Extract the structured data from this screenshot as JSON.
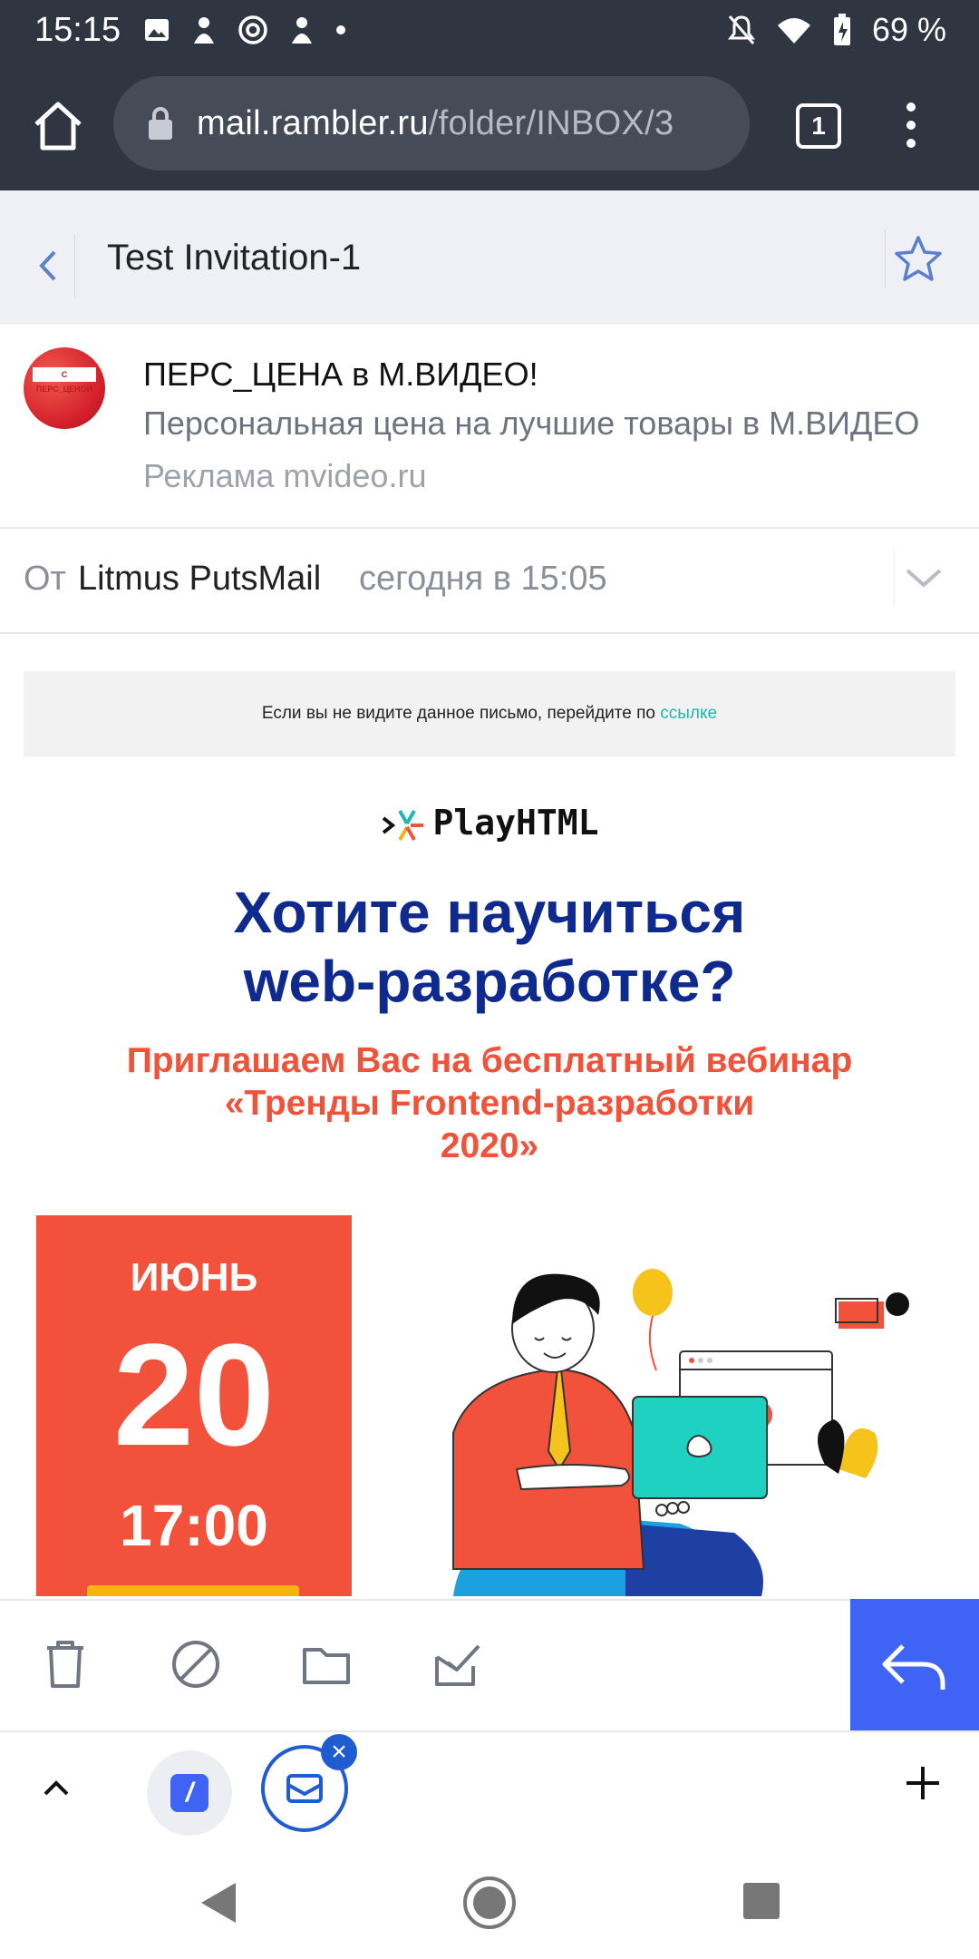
{
  "status_bar": {
    "time": "15:15",
    "battery": "69 %"
  },
  "browser": {
    "url_host": "mail.rambler.ru",
    "url_path": "/folder/INBOX/3",
    "tab_count": "1"
  },
  "mail": {
    "subject": "Test Invitation-1",
    "ad": {
      "avatar_text": "С ПЕРС_ЦЕНОЙ",
      "title": "ПЕРС_ЦЕНА в М.ВИДЕО!",
      "description": "Персональная цена на лучшие товары в М.ВИДЕО",
      "source": "Реклама mvideo.ru"
    },
    "from_label": "От",
    "from_name": "Litmus PutsMail",
    "received": "сегодня в 15:05"
  },
  "email_body": {
    "banner_text": "Если вы не видите данное письмо, перейдите по ",
    "banner_link": "ссылке",
    "logo_text": "PlayHTML",
    "headline_line1": "Хотите научиться",
    "headline_line2": "web-разработке?",
    "subhead": "Приглашаем Вас на бесплатный вебинар\n«Тренды Frontend-разработки\n2020»",
    "date_month": "ИЮНЬ",
    "date_day": "20",
    "date_time": "17:00"
  },
  "colors": {
    "accent_blue": "#3f63f4",
    "headline": "#0f2a8f",
    "promo_red": "#f2513b",
    "link": "#1fb7b1"
  },
  "icons": {
    "home": "home-icon",
    "lock": "lock-icon",
    "menu": "more-vert-icon",
    "back": "chevron-left-icon",
    "star": "star-icon",
    "expand": "chevron-down-icon",
    "delete": "trash-icon",
    "spam": "block-icon",
    "move": "folder-icon",
    "mark_read": "mark-read-icon",
    "reply": "reply-icon"
  }
}
